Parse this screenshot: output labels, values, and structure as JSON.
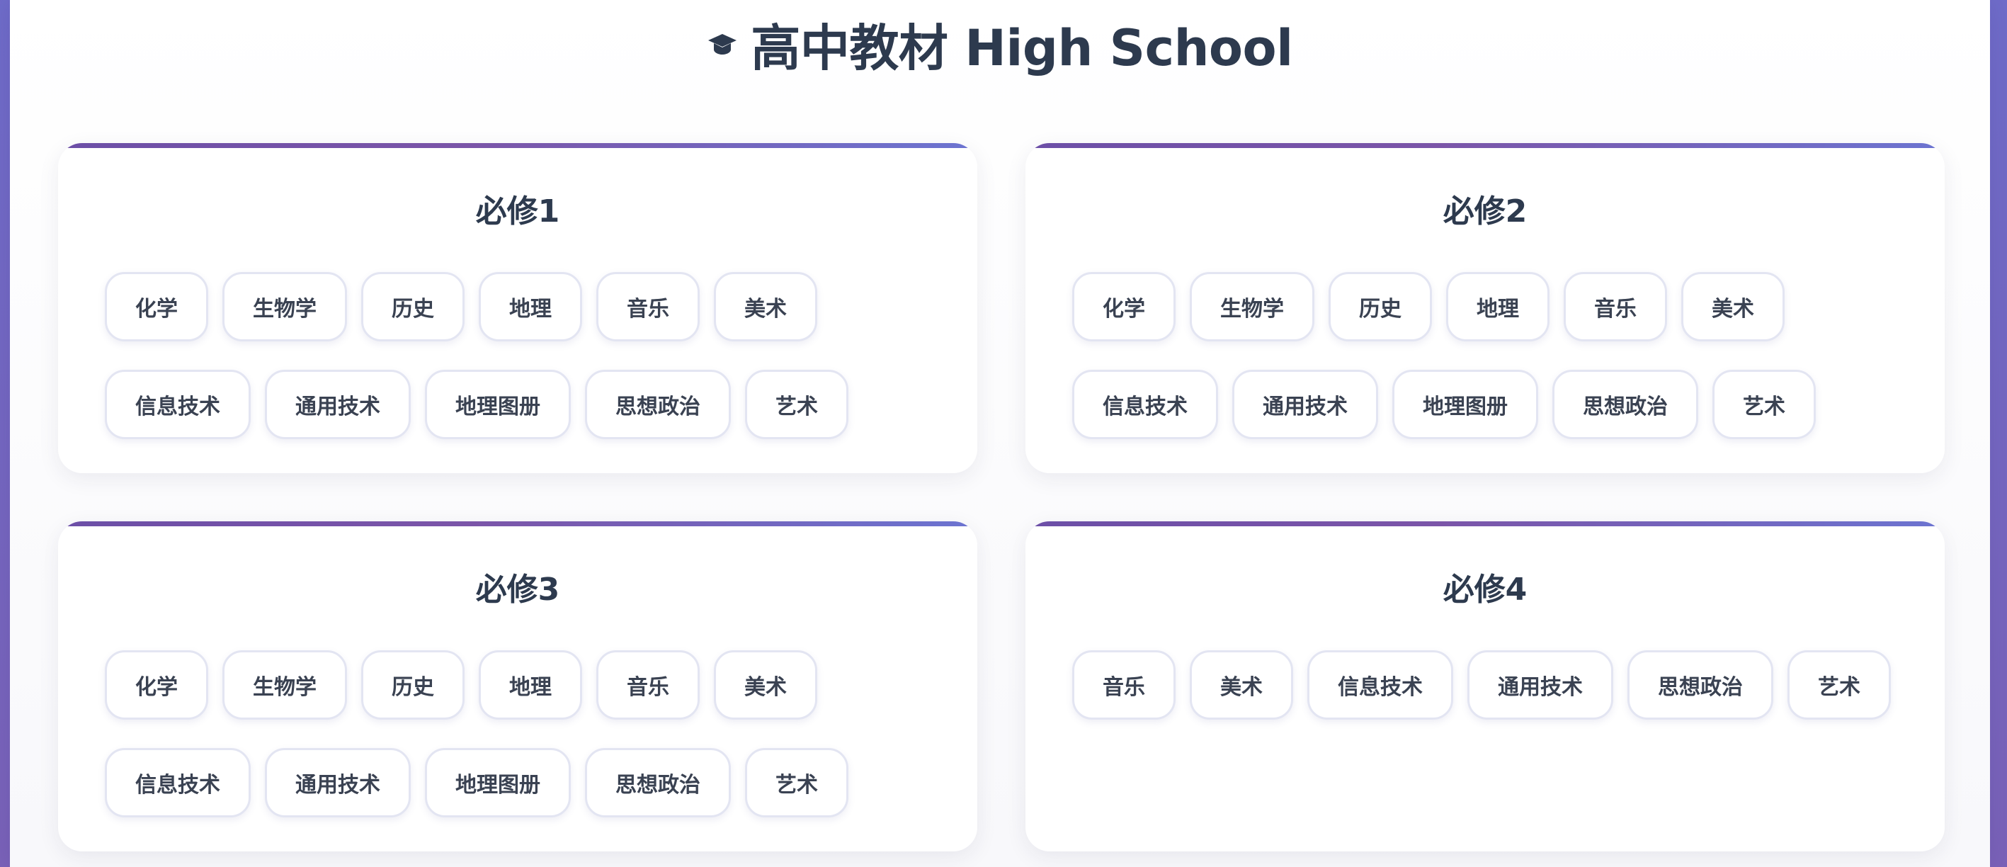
{
  "header": {
    "title": "高中教材 High School",
    "icon": "graduation-cap-icon"
  },
  "cards": [
    {
      "title": "必修1",
      "tags": [
        "化学",
        "生物学",
        "历史",
        "地理",
        "音乐",
        "美术",
        "信息技术",
        "通用技术",
        "地理图册",
        "思想政治",
        "艺术"
      ]
    },
    {
      "title": "必修2",
      "tags": [
        "化学",
        "生物学",
        "历史",
        "地理",
        "音乐",
        "美术",
        "信息技术",
        "通用技术",
        "地理图册",
        "思想政治",
        "艺术"
      ]
    },
    {
      "title": "必修3",
      "tags": [
        "化学",
        "生物学",
        "历史",
        "地理",
        "音乐",
        "美术",
        "信息技术",
        "通用技术",
        "地理图册",
        "思想政治",
        "艺术"
      ]
    },
    {
      "title": "必修4",
      "tags": [
        "音乐",
        "美术",
        "信息技术",
        "通用技术",
        "思想政治",
        "艺术"
      ]
    }
  ],
  "colors": {
    "background": "#6f6cc9",
    "accent_bar": "#7b55a8",
    "title_text": "#2d3a4e",
    "tag_border": "#e3e5f2"
  }
}
